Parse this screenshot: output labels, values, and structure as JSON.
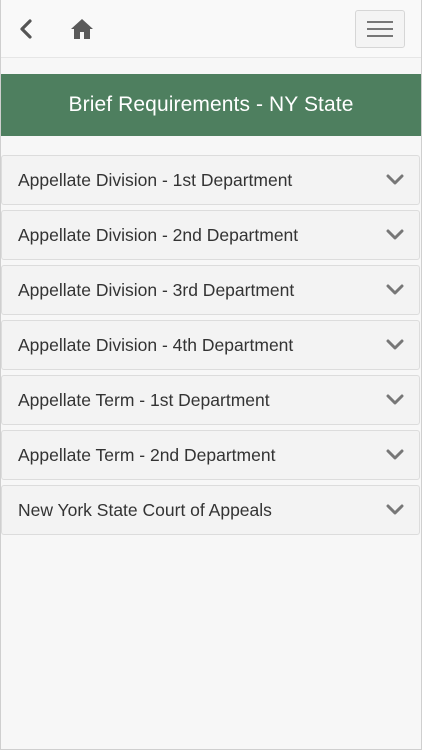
{
  "nav": {
    "back_icon": "chevron-left-icon",
    "home_icon": "home-icon",
    "menu_icon": "hamburger-menu-icon"
  },
  "header": {
    "title": "Brief Requirements - NY State",
    "background": "#4e7f5f"
  },
  "courts": [
    {
      "label": "Appellate Division - 1st Department"
    },
    {
      "label": "Appellate Division - 2nd Department"
    },
    {
      "label": "Appellate Division - 3rd Department"
    },
    {
      "label": "Appellate Division - 4th Department"
    },
    {
      "label": "Appellate Term - 1st Department"
    },
    {
      "label": "Appellate Term - 2nd Department"
    },
    {
      "label": "New York State Court of Appeals"
    }
  ],
  "item_icon": "chevron-down-icon"
}
